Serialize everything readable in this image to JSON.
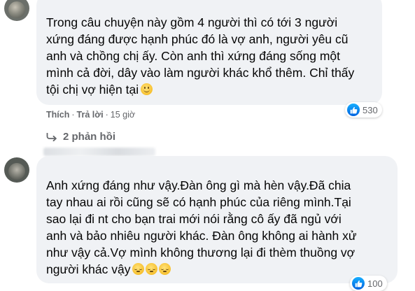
{
  "comments": [
    {
      "lines": [
        "Trong câu chuyện này gồm 4 người thì có tới 3 người",
        "xứng đáng được hạnh phúc đó là vợ anh, người yêu cũ",
        "anh và chồng chị ấy. Còn anh thì xứng đáng sống một",
        "mình cả đời, dây vào làm người khác khổ thêm. Chỉ thấy",
        "tội chị vợ hiện tại"
      ],
      "emoji": [
        "smiling-face-emoji"
      ],
      "like_label": "Thích",
      "reply_label": "Trả lời",
      "time": "15 giờ",
      "reaction_count": "530",
      "replies_label": "2 phản hồi"
    },
    {
      "lines": [
        "Anh xứng đáng như vậy.Đàn ông gì mà hèn vậy.Đã chia",
        "tay nhau ai rồi cũng sẽ có hạnh phúc của riêng mình.Tại",
        "sao lại đi nt cho bạn trai mới nói rằng cô ấy đã ngủ với",
        "anh và bảo nhiêu người khác. Đàn ông không ai hành xử",
        "như vậy cả.Vợ mình không thương lại đi thèm thuồng vợ",
        "người khác vậy"
      ],
      "emoji": [
        "pensive-face-emoji",
        "pensive-face-emoji",
        "pensive-face-emoji"
      ],
      "reaction_count": "100"
    }
  ],
  "colors": {
    "bubble": "#f0f2f5",
    "text": "#050505",
    "meta": "#65676b",
    "like_blue": "#0571ed"
  }
}
